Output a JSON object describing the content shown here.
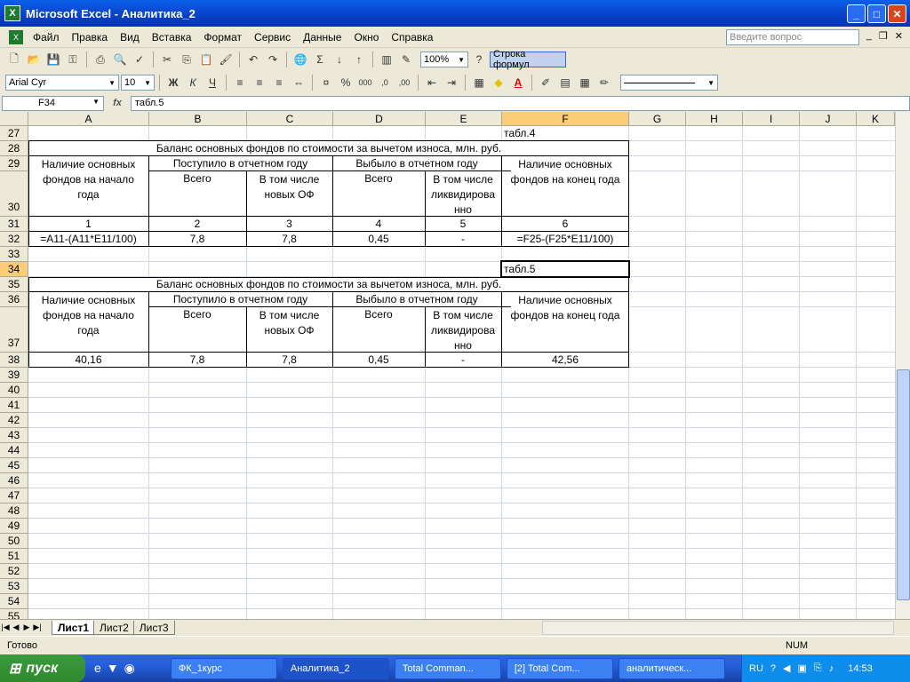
{
  "window": {
    "title": "Microsoft Excel - Аналитика_2"
  },
  "menu": {
    "items": [
      "Файл",
      "Правка",
      "Вид",
      "Вставка",
      "Формат",
      "Сервис",
      "Данные",
      "Окно",
      "Справка"
    ],
    "ask_placeholder": "Введите вопрос"
  },
  "toolbar": {
    "zoom": "100%",
    "formula_bar_btn": "Строка формул",
    "font": "Arial Cyr",
    "size": "10",
    "bold": "Ж",
    "italic": "К",
    "underline": "Ч"
  },
  "formula": {
    "cell": "F34",
    "fx": "fx",
    "content": "табл.5"
  },
  "columns": [
    "A",
    "B",
    "C",
    "D",
    "E",
    "F",
    "G",
    "H",
    "I",
    "J",
    "K"
  ],
  "rows": [
    "27",
    "28",
    "29",
    "30",
    "31",
    "32",
    "33",
    "34",
    "35",
    "36",
    "37",
    "38",
    "39",
    "40",
    "41",
    "42",
    "43",
    "44",
    "45",
    "46",
    "47",
    "48",
    "49",
    "50",
    "51",
    "52",
    "53",
    "54",
    "55"
  ],
  "selected": {
    "col": "F",
    "row": "34"
  },
  "table4": {
    "label": "табл.4",
    "title": "Баланс основных фондов по стоимости за вычетом износа, млн. руб.",
    "h_a": [
      "Наличие основных",
      "фондов на начало",
      "года"
    ],
    "h_bc": "Поступило в отчетном году",
    "h_de": "Выбыло в отчетном году",
    "h_f": [
      "Наличие основных",
      "фондов на конец года"
    ],
    "h_b": "Всего",
    "h_c": [
      "В том числе",
      "новых ОФ"
    ],
    "h_d": "Всего",
    "h_e": [
      "В том числе",
      "ликвидирова",
      "нно"
    ],
    "nums": [
      "1",
      "2",
      "3",
      "4",
      "5",
      "6"
    ],
    "vals": [
      "=A11-(A11*E11/100)",
      "7,8",
      "7,8",
      "0,45",
      "-",
      "=F25-(F25*E11/100)"
    ]
  },
  "table5": {
    "label": "табл.5",
    "title": "Баланс основных фондов по стоимости за вычетом износа, млн. руб.",
    "h_a": [
      "Наличие основных",
      "фондов на начало",
      "года"
    ],
    "h_bc": "Поступило в отчетном году",
    "h_de": "Выбыло в отчетном году",
    "h_f": [
      "Наличие основных",
      "фондов на конец года"
    ],
    "h_b": "Всего",
    "h_c": [
      "В том числе",
      "новых ОФ"
    ],
    "h_d": "Всего",
    "h_e": [
      "В том числе",
      "ликвидирова",
      "нно"
    ],
    "vals": [
      "40,16",
      "7,8",
      "7,8",
      "0,45",
      "-",
      "42,56"
    ]
  },
  "sheets": [
    "Лист1",
    "Лист2",
    "Лист3"
  ],
  "status": {
    "ready": "Готово",
    "num": "NUM"
  },
  "taskbar": {
    "start": "пуск",
    "buttons": [
      "ФК_1курс",
      "Аналитика_2",
      "Total Comman...",
      "[2] Total Com...",
      "аналитическ..."
    ],
    "lang": "RU",
    "clock": "14:53"
  }
}
